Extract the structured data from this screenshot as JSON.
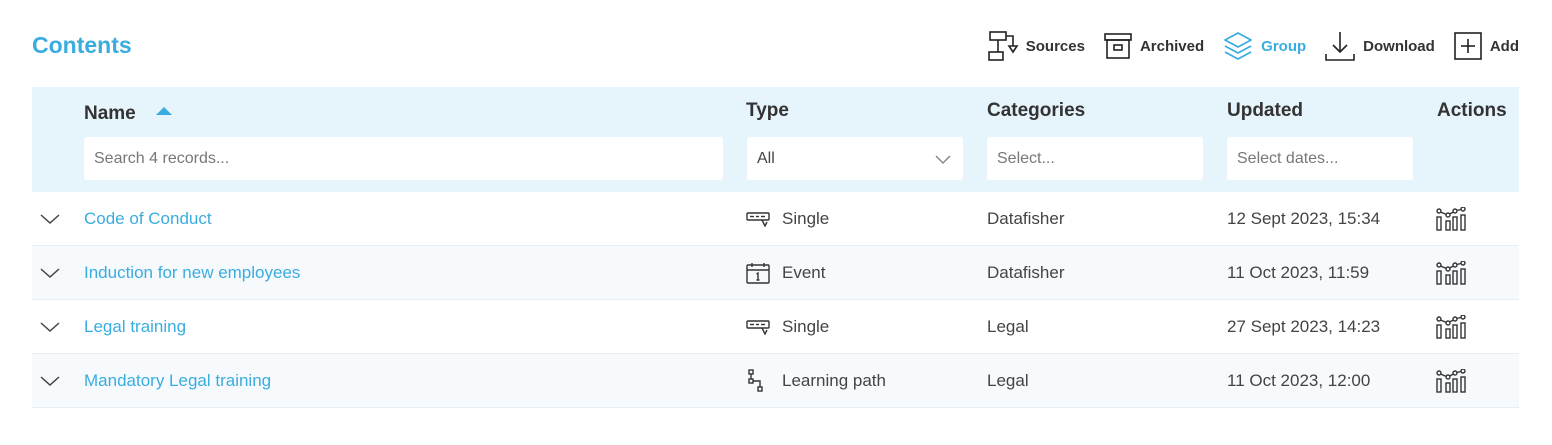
{
  "header": {
    "title": "Contents"
  },
  "toolbar": {
    "items": [
      {
        "label": "Sources",
        "icon": "sources-icon"
      },
      {
        "label": "Archived",
        "icon": "archive-icon"
      },
      {
        "label": "Group",
        "icon": "layers-icon",
        "active": true
      },
      {
        "label": "Download",
        "icon": "download-icon"
      },
      {
        "label": "Add",
        "icon": "plus-box-icon"
      }
    ],
    "active_color": "#3aace0"
  },
  "table": {
    "columns": {
      "name": "Name",
      "type": "Type",
      "categories": "Categories",
      "updated": "Updated",
      "actions": "Actions"
    },
    "sort": {
      "column": "Name",
      "direction": "ascending",
      "icon": "sort-asc-icon"
    },
    "filters": {
      "name_placeholder": "Search 4 records...",
      "type_value": "All",
      "categories_placeholder": "Select...",
      "updated_placeholder": "Select dates..."
    },
    "rows": [
      {
        "name": "Code of Conduct",
        "type": "Single",
        "type_icon": "single-content-icon",
        "category": "Datafisher",
        "updated": "12 Sept 2023, 15:34",
        "action_icon": "statistics-icon"
      },
      {
        "name": "Induction for new employees",
        "type": "Event",
        "type_icon": "calendar-event-icon",
        "category": "Datafisher",
        "updated": "11 Oct 2023, 11:59",
        "action_icon": "statistics-icon"
      },
      {
        "name": "Legal training",
        "type": "Single",
        "type_icon": "single-content-icon",
        "category": "Legal",
        "updated": "27 Sept 2023, 14:23",
        "action_icon": "statistics-icon"
      },
      {
        "name": "Mandatory Legal training",
        "type": "Learning path",
        "type_icon": "learning-path-icon",
        "category": "Legal",
        "updated": "11 Oct 2023, 12:00",
        "action_icon": "statistics-icon"
      }
    ]
  },
  "colors": {
    "accent": "#3aace0",
    "header_bg": "#e6f4fc",
    "text": "#333333"
  }
}
